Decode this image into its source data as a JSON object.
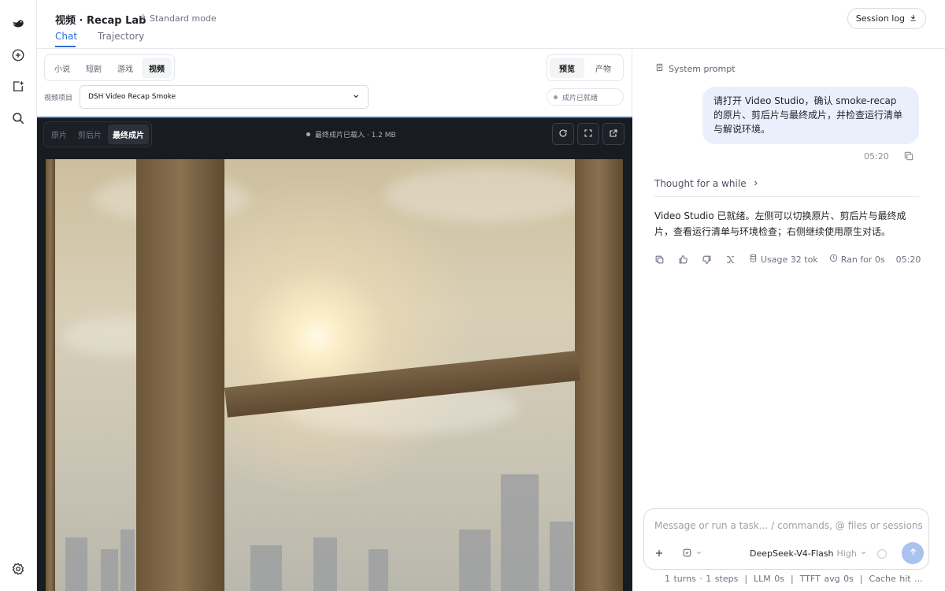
{
  "rail": {
    "items": [
      "logo-icon",
      "new-chat-icon",
      "new-note-icon",
      "search-icon",
      "settings-icon"
    ]
  },
  "header": {
    "title": "视频 · Recap Lab",
    "mode": "Standard mode",
    "tabs": [
      {
        "label": "Chat",
        "active": true
      },
      {
        "label": "Trajectory",
        "active": false
      }
    ],
    "session_log": "Session log"
  },
  "studio": {
    "categories": [
      {
        "label": "小说",
        "active": false
      },
      {
        "label": "短剧",
        "active": false
      },
      {
        "label": "游戏",
        "active": false
      },
      {
        "label": "视频",
        "active": true
      }
    ],
    "view_tabs": [
      {
        "label": "预览",
        "active": true
      },
      {
        "label": "产物",
        "active": false
      }
    ],
    "project_label": "视频项目",
    "project_value": "DSH Video Recap Smoke",
    "ready_status": "成片已就绪",
    "player": {
      "tabs": [
        {
          "label": "原片",
          "active": false
        },
        {
          "label": "剪后片",
          "active": false
        },
        {
          "label": "最终成片",
          "active": true
        }
      ],
      "status": "最终成片已载入 · 1.2 MB",
      "buttons": [
        "refresh-icon",
        "fullscreen-icon",
        "open-external-icon"
      ]
    }
  },
  "chat": {
    "system_prompt": "System prompt",
    "user_message": "请打开 Video Studio，确认 smoke-recap 的原片、剪后片与最终成片，并检查运行清单与解说环境。",
    "user_time": "05:20",
    "thought": "Thought for a while",
    "assistant_message": "Video Studio 已就绪。左侧可以切换原片、剪后片与最终成片，查看运行清单与环境检查；右侧继续使用原生对话。",
    "usage": "Usage 32 tok",
    "ran_for": "Ran for 0s",
    "assistant_time": "05:20",
    "composer_placeholder": "Message or run a task... / commands, @ files or sessions",
    "model": "DeepSeek-V4-Flash",
    "level": "High",
    "stats": [
      "1 turns · 1 steps",
      "LLM 0s",
      "TTFT avg 0s",
      "Cache hit ..."
    ]
  },
  "colors": {
    "accent": "#2f6fd6",
    "user_bubble": "#e9effb",
    "player_bg": "#181b20",
    "send_button": "#a9c2ee"
  }
}
